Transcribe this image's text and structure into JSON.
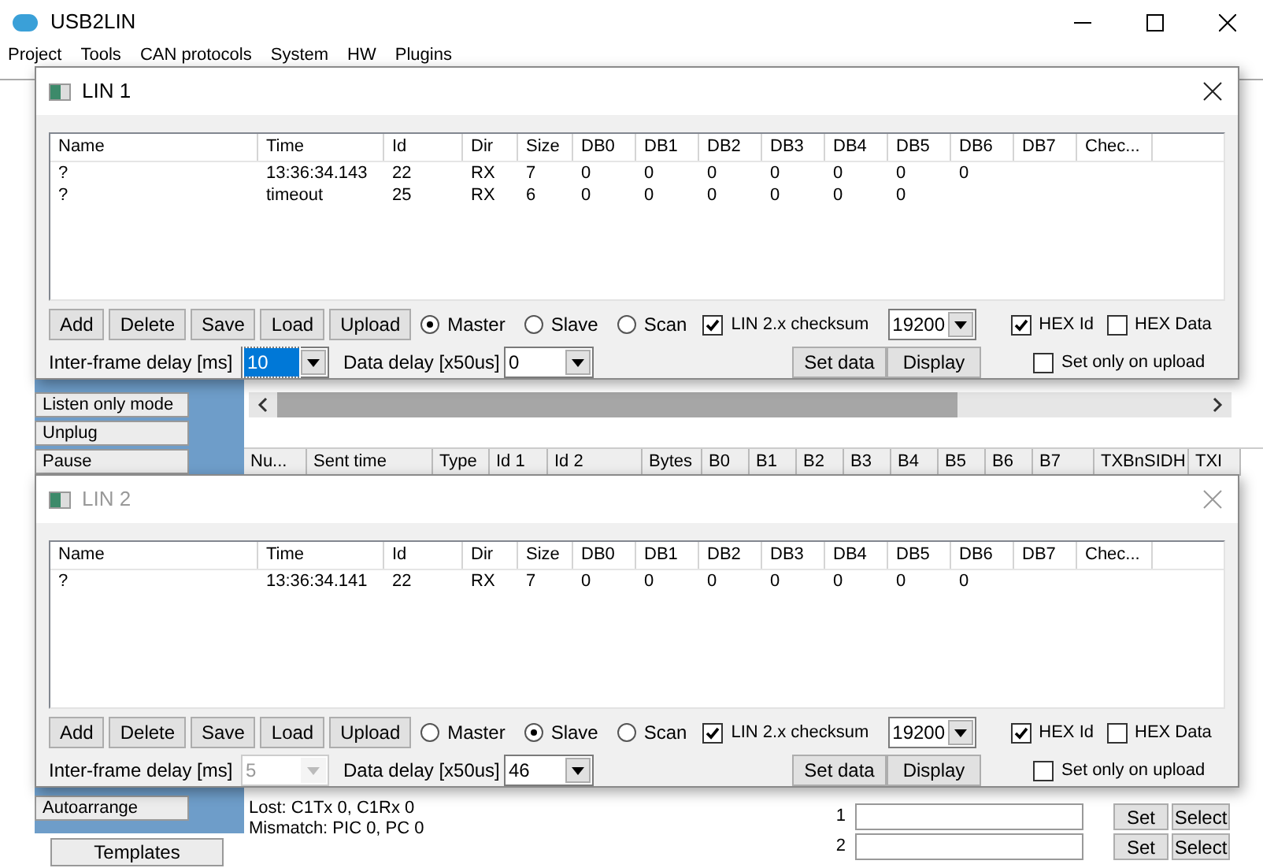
{
  "main_window": {
    "title": "USB2LIN"
  },
  "menu": [
    "Project",
    "Tools",
    "CAN protocols",
    "System",
    "HW",
    "Plugins"
  ],
  "sidebar_buttons": [
    "Listen only mode",
    "Unplug",
    "Pause"
  ],
  "autoarrange_button": "Autoarrange",
  "templates_button": "Templates",
  "message_table": {
    "columns": [
      "Nu...",
      "Sent time",
      "Type",
      "Id 1",
      "Id 2",
      "Bytes",
      "B0",
      "B1",
      "B2",
      "B3",
      "B4",
      "B5",
      "B6",
      "B7",
      "TXBnSIDH",
      "TXI"
    ]
  },
  "log_lines": [
    "Lost: C1Tx 0, C1Rx 0",
    "Mismatch: PIC 0, PC 0"
  ],
  "slots": [
    {
      "index": "1",
      "set": "Set",
      "select": "Select"
    },
    {
      "index": "2",
      "set": "Set",
      "select": "Select"
    }
  ],
  "lin_windows": [
    {
      "title": "LIN 1",
      "active": true,
      "columns": [
        "Name",
        "Time",
        "Id",
        "Dir",
        "Size",
        "DB0",
        "DB1",
        "DB2",
        "DB3",
        "DB4",
        "DB5",
        "DB6",
        "DB7",
        "Chec..."
      ],
      "rows": [
        [
          "?",
          "13:36:34.143",
          "22",
          "RX",
          "7",
          "0",
          "0",
          "0",
          "0",
          "0",
          "0",
          "0"
        ],
        [
          "?",
          "timeout",
          "25",
          "RX",
          "6",
          "0",
          "0",
          "0",
          "0",
          "0",
          "0"
        ]
      ],
      "buttons": [
        "Add",
        "Delete",
        "Save",
        "Load",
        "Upload"
      ],
      "modes": [
        {
          "label": "Master",
          "selected": true
        },
        {
          "label": "Slave",
          "selected": false
        },
        {
          "label": "Scan",
          "selected": false
        }
      ],
      "checksum": {
        "label": "LIN 2.x checksum",
        "checked": true
      },
      "baud": "19200",
      "hex_id": {
        "label": "HEX Id",
        "checked": true
      },
      "hex_data": {
        "label": "HEX Data",
        "checked": false
      },
      "interframe": {
        "label": "Inter-frame delay [ms]",
        "value": "10",
        "focused": true,
        "disabled": false
      },
      "data_delay": {
        "label": "Data delay [x50us]",
        "value": "0"
      },
      "set_data": "Set data",
      "display": "Display",
      "set_only_on_upload": {
        "label": "Set only on upload",
        "checked": false
      }
    },
    {
      "title": "LIN 2",
      "active": false,
      "columns": [
        "Name",
        "Time",
        "Id",
        "Dir",
        "Size",
        "DB0",
        "DB1",
        "DB2",
        "DB3",
        "DB4",
        "DB5",
        "DB6",
        "DB7",
        "Chec..."
      ],
      "rows": [
        [
          "?",
          "13:36:34.141",
          "22",
          "RX",
          "7",
          "0",
          "0",
          "0",
          "0",
          "0",
          "0",
          "0"
        ]
      ],
      "buttons": [
        "Add",
        "Delete",
        "Save",
        "Load",
        "Upload"
      ],
      "modes": [
        {
          "label": "Master",
          "selected": false
        },
        {
          "label": "Slave",
          "selected": true
        },
        {
          "label": "Scan",
          "selected": false
        }
      ],
      "checksum": {
        "label": "LIN 2.x checksum",
        "checked": true
      },
      "baud": "19200",
      "hex_id": {
        "label": "HEX Id",
        "checked": true
      },
      "hex_data": {
        "label": "HEX Data",
        "checked": false
      },
      "interframe": {
        "label": "Inter-frame delay [ms]",
        "value": "5",
        "focused": false,
        "disabled": true
      },
      "data_delay": {
        "label": "Data delay [x50us]",
        "value": "46"
      },
      "set_data": "Set data",
      "display": "Display",
      "set_only_on_upload": {
        "label": "Set only on upload",
        "checked": false
      }
    }
  ]
}
